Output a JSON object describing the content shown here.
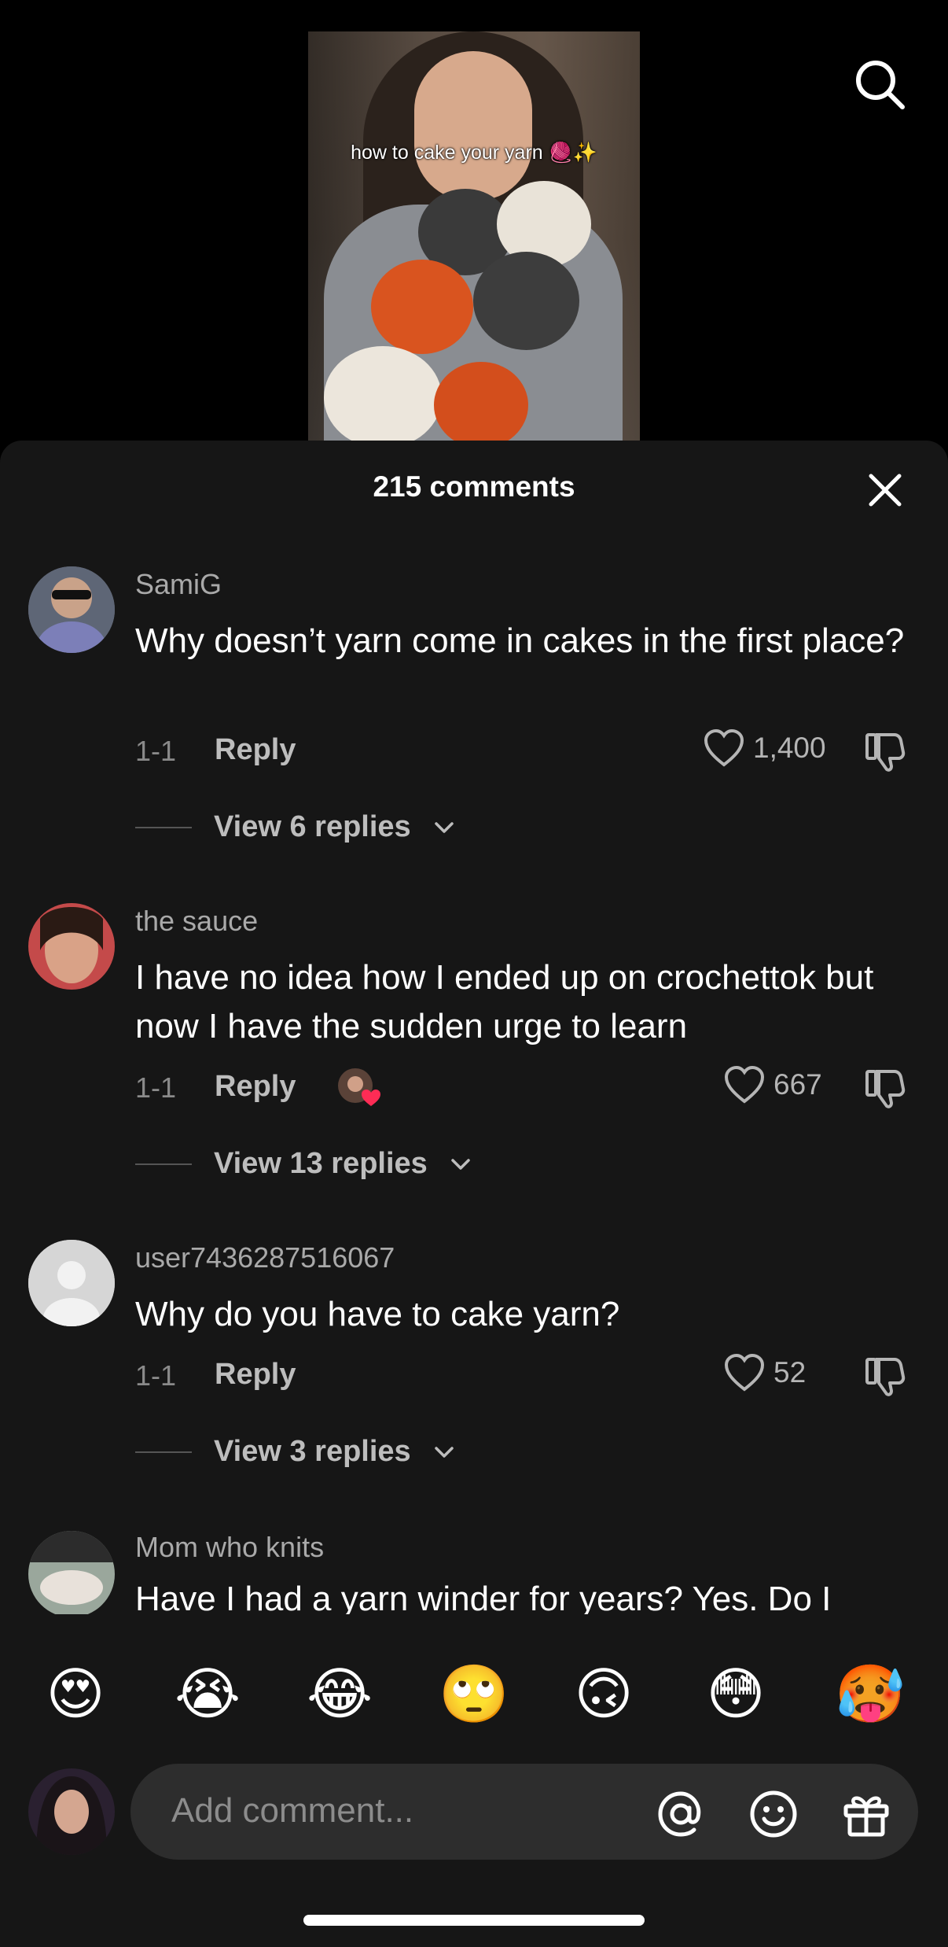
{
  "video": {
    "caption": "how to cake your yarn 🧶✨"
  },
  "header": {
    "title": "215 comments"
  },
  "comments": [
    {
      "username": "SamiG",
      "text": "Why doesn’t yarn come in cakes in the first place?",
      "date": "1-1",
      "reply_label": "Reply",
      "likes": "1,400",
      "view_replies": "View 6 replies"
    },
    {
      "username": "the sauce",
      "text": "I have no idea how I ended up on crochettok but now I have the sudden urge to learn",
      "date": "1-1",
      "reply_label": "Reply",
      "likes": "667",
      "view_replies": "View 13 replies"
    },
    {
      "username": "user7436287516067",
      "text": "Why do you have to cake yarn?",
      "date": "1-1",
      "reply_label": "Reply",
      "likes": "52",
      "view_replies": "View 3 replies"
    },
    {
      "username": "Mom who knits",
      "text": "Have I had a yarn winder for years? Yes. Do I"
    }
  ],
  "emojis": [
    "😍",
    "😭",
    "😂",
    "🙄",
    "🙃",
    "😳",
    "🥵"
  ],
  "composer": {
    "placeholder": "Add comment..."
  },
  "icons": {
    "search": "search-icon",
    "close": "close-icon",
    "heart": "heart-icon",
    "dislike": "thumbs-down-icon",
    "mention": "at-icon",
    "emoji": "smiley-icon",
    "gift": "gift-icon"
  },
  "colors": {
    "background": "#000000",
    "sheet": "#161616",
    "input": "#2d2d2d",
    "muted_text": "#a9a9a9"
  }
}
